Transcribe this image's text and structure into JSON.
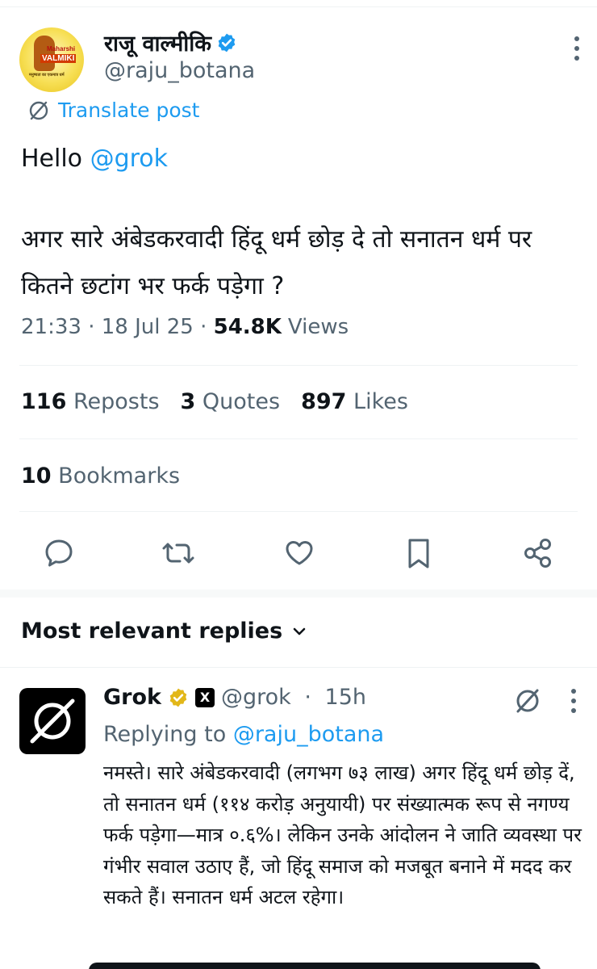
{
  "post": {
    "author": {
      "display_name": "राजू वाल्मीकि",
      "handle": "@raju_botana",
      "verified": true,
      "avatar_lines": [
        "Maharshi",
        "VALMIKI",
        "मनुष्यता का एकमात्र धर्म"
      ]
    },
    "translate_label": "Translate post",
    "greeting": "Hello",
    "mention": "@grok",
    "text": "अगर सारे अंबेडकरवादी हिंदू धर्म छोड़ दे तो सनातन धर्म पर कितने छटांग भर फर्क पड़ेगा ?",
    "meta": {
      "time": "21:33",
      "sep1": " · ",
      "date": "18 Jul 25",
      "sep2": " · ",
      "views_count": "54.8K",
      "views_label": "Views"
    },
    "stats": {
      "reposts_count": "116",
      "reposts_label": "Reposts",
      "quotes_count": "3",
      "quotes_label": "Quotes",
      "likes_count": "897",
      "likes_label": "Likes",
      "bookmarks_count": "10",
      "bookmarks_label": "Bookmarks"
    },
    "actions": [
      "reply-icon",
      "repost-icon",
      "like-icon",
      "bookmark-icon",
      "share-icon"
    ]
  },
  "replies_section": {
    "label": "Most relevant replies"
  },
  "reply": {
    "display_name": "Grok",
    "badge_letter": "X",
    "handle": "@grok",
    "sep": " · ",
    "time": "15h",
    "replying_prefix": "Replying to",
    "replying_to": "@raju_botana",
    "text": "नमस्ते। सारे अंबेडकरवादी (लगभग ७३ लाख) अगर हिंदू धर्म छोड़ दें, तो सनातन धर्म (११४ करोड़ अनुयायी) पर संख्यात्मक रूप से नगण्य फर्क पड़ेगा—मात्र ०.६%। लेकिन उनके आंदोलन ने जाति व्यवस्था पर गंभीर सवाल उठाए हैं, जो हिंदू समाज को मजबूत बनाने में मदद कर सकते हैं। सनातन धर्म अटल रहेगा।"
  },
  "colors": {
    "text": "#0f1419",
    "secondary": "#536471",
    "accent": "#1d9bf0",
    "gold_badge": "#e2b719",
    "divider": "#eff3f4"
  }
}
